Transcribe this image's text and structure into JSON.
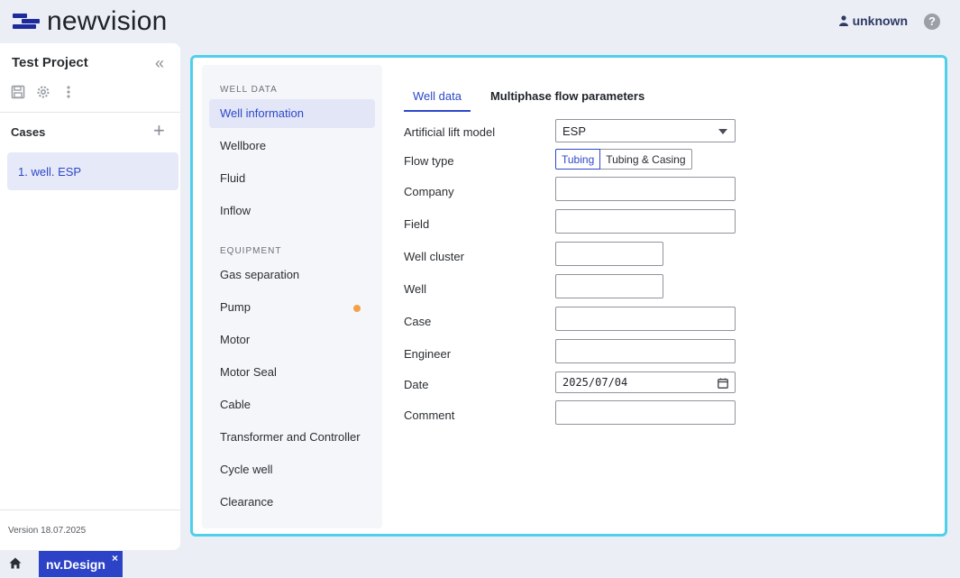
{
  "brand": {
    "name": "newvision",
    "color": "#1d2b9c"
  },
  "header": {
    "user": "unknown",
    "help_icon": "question-circle-icon"
  },
  "sidebar": {
    "project_title": "Test Project",
    "cases_label": "Cases",
    "cases": [
      {
        "label": "1. well. ESP"
      }
    ],
    "version": "Version 18.07.2025"
  },
  "nav": {
    "groups": [
      {
        "label": "WELL DATA",
        "items": [
          "Well information",
          "Wellbore",
          "Fluid",
          "Inflow"
        ]
      },
      {
        "label": "EQUIPMENT",
        "items": [
          "Gas separation",
          "Pump",
          "Motor",
          "Motor Seal",
          "Cable",
          "Transformer and Controller",
          "Cycle well",
          "Clearance"
        ]
      }
    ],
    "active": "Well information",
    "flagged": "Pump",
    "flag_color": "#f3a14a"
  },
  "tabs": [
    {
      "label": "Well data",
      "active": true
    },
    {
      "label": "Multiphase flow parameters",
      "active": false
    }
  ],
  "form": {
    "artificial_lift_model": {
      "label": "Artificial lift model",
      "value": "ESP"
    },
    "flow_type": {
      "label": "Flow type",
      "options": [
        "Tubing",
        "Tubing & Casing"
      ],
      "selected": "Tubing"
    },
    "company": {
      "label": "Company",
      "value": ""
    },
    "field": {
      "label": "Field",
      "value": ""
    },
    "well_cluster": {
      "label": "Well cluster",
      "value": ""
    },
    "well": {
      "label": "Well",
      "value": ""
    },
    "case": {
      "label": "Case",
      "value": ""
    },
    "engineer": {
      "label": "Engineer",
      "value": ""
    },
    "date": {
      "label": "Date",
      "value": "2025/07/04"
    },
    "comment": {
      "label": "Comment",
      "value": ""
    }
  },
  "bottom": {
    "app_tab": "nv.Design",
    "close_glyph": "×"
  },
  "accent": "#2e48c9",
  "focus_border": "#4fd0ea"
}
